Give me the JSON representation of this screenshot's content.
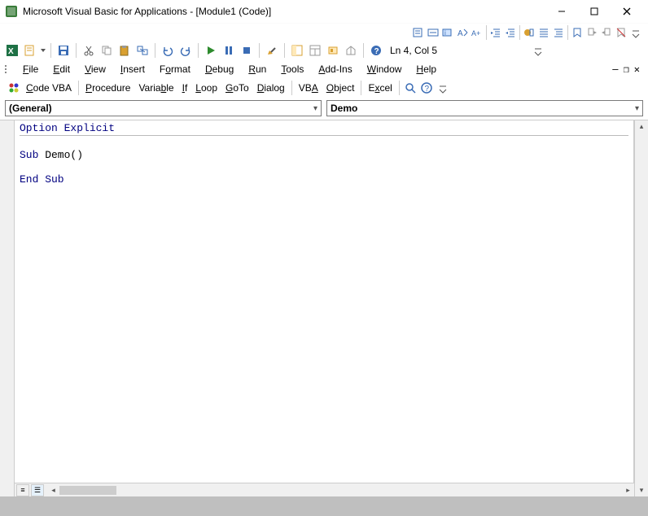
{
  "window": {
    "title": "Microsoft Visual Basic for Applications - [Module1 (Code)]"
  },
  "menu": {
    "file": "File",
    "edit": "Edit",
    "view": "View",
    "insert": "Insert",
    "format": "Format",
    "debug": "Debug",
    "run": "Run",
    "tools": "Tools",
    "addins": "Add-Ins",
    "window": "Window",
    "help": "Help"
  },
  "cursor_status": "Ln 4, Col 5",
  "codevba_menu": {
    "codevba": "Code VBA",
    "procedure": "Procedure",
    "variable": "Variable",
    "if": "If",
    "loop": "Loop",
    "goto": "GoTo",
    "dialog": "Dialog",
    "vba": "VBA",
    "object": "Object",
    "excel": "Excel"
  },
  "dropdowns": {
    "object": "(General)",
    "procedure": "Demo"
  },
  "code": {
    "line1_kw": "Option Explicit",
    "line3_kw": "Sub",
    "line3_rest": " Demo()",
    "line5_kw": "End Sub"
  }
}
